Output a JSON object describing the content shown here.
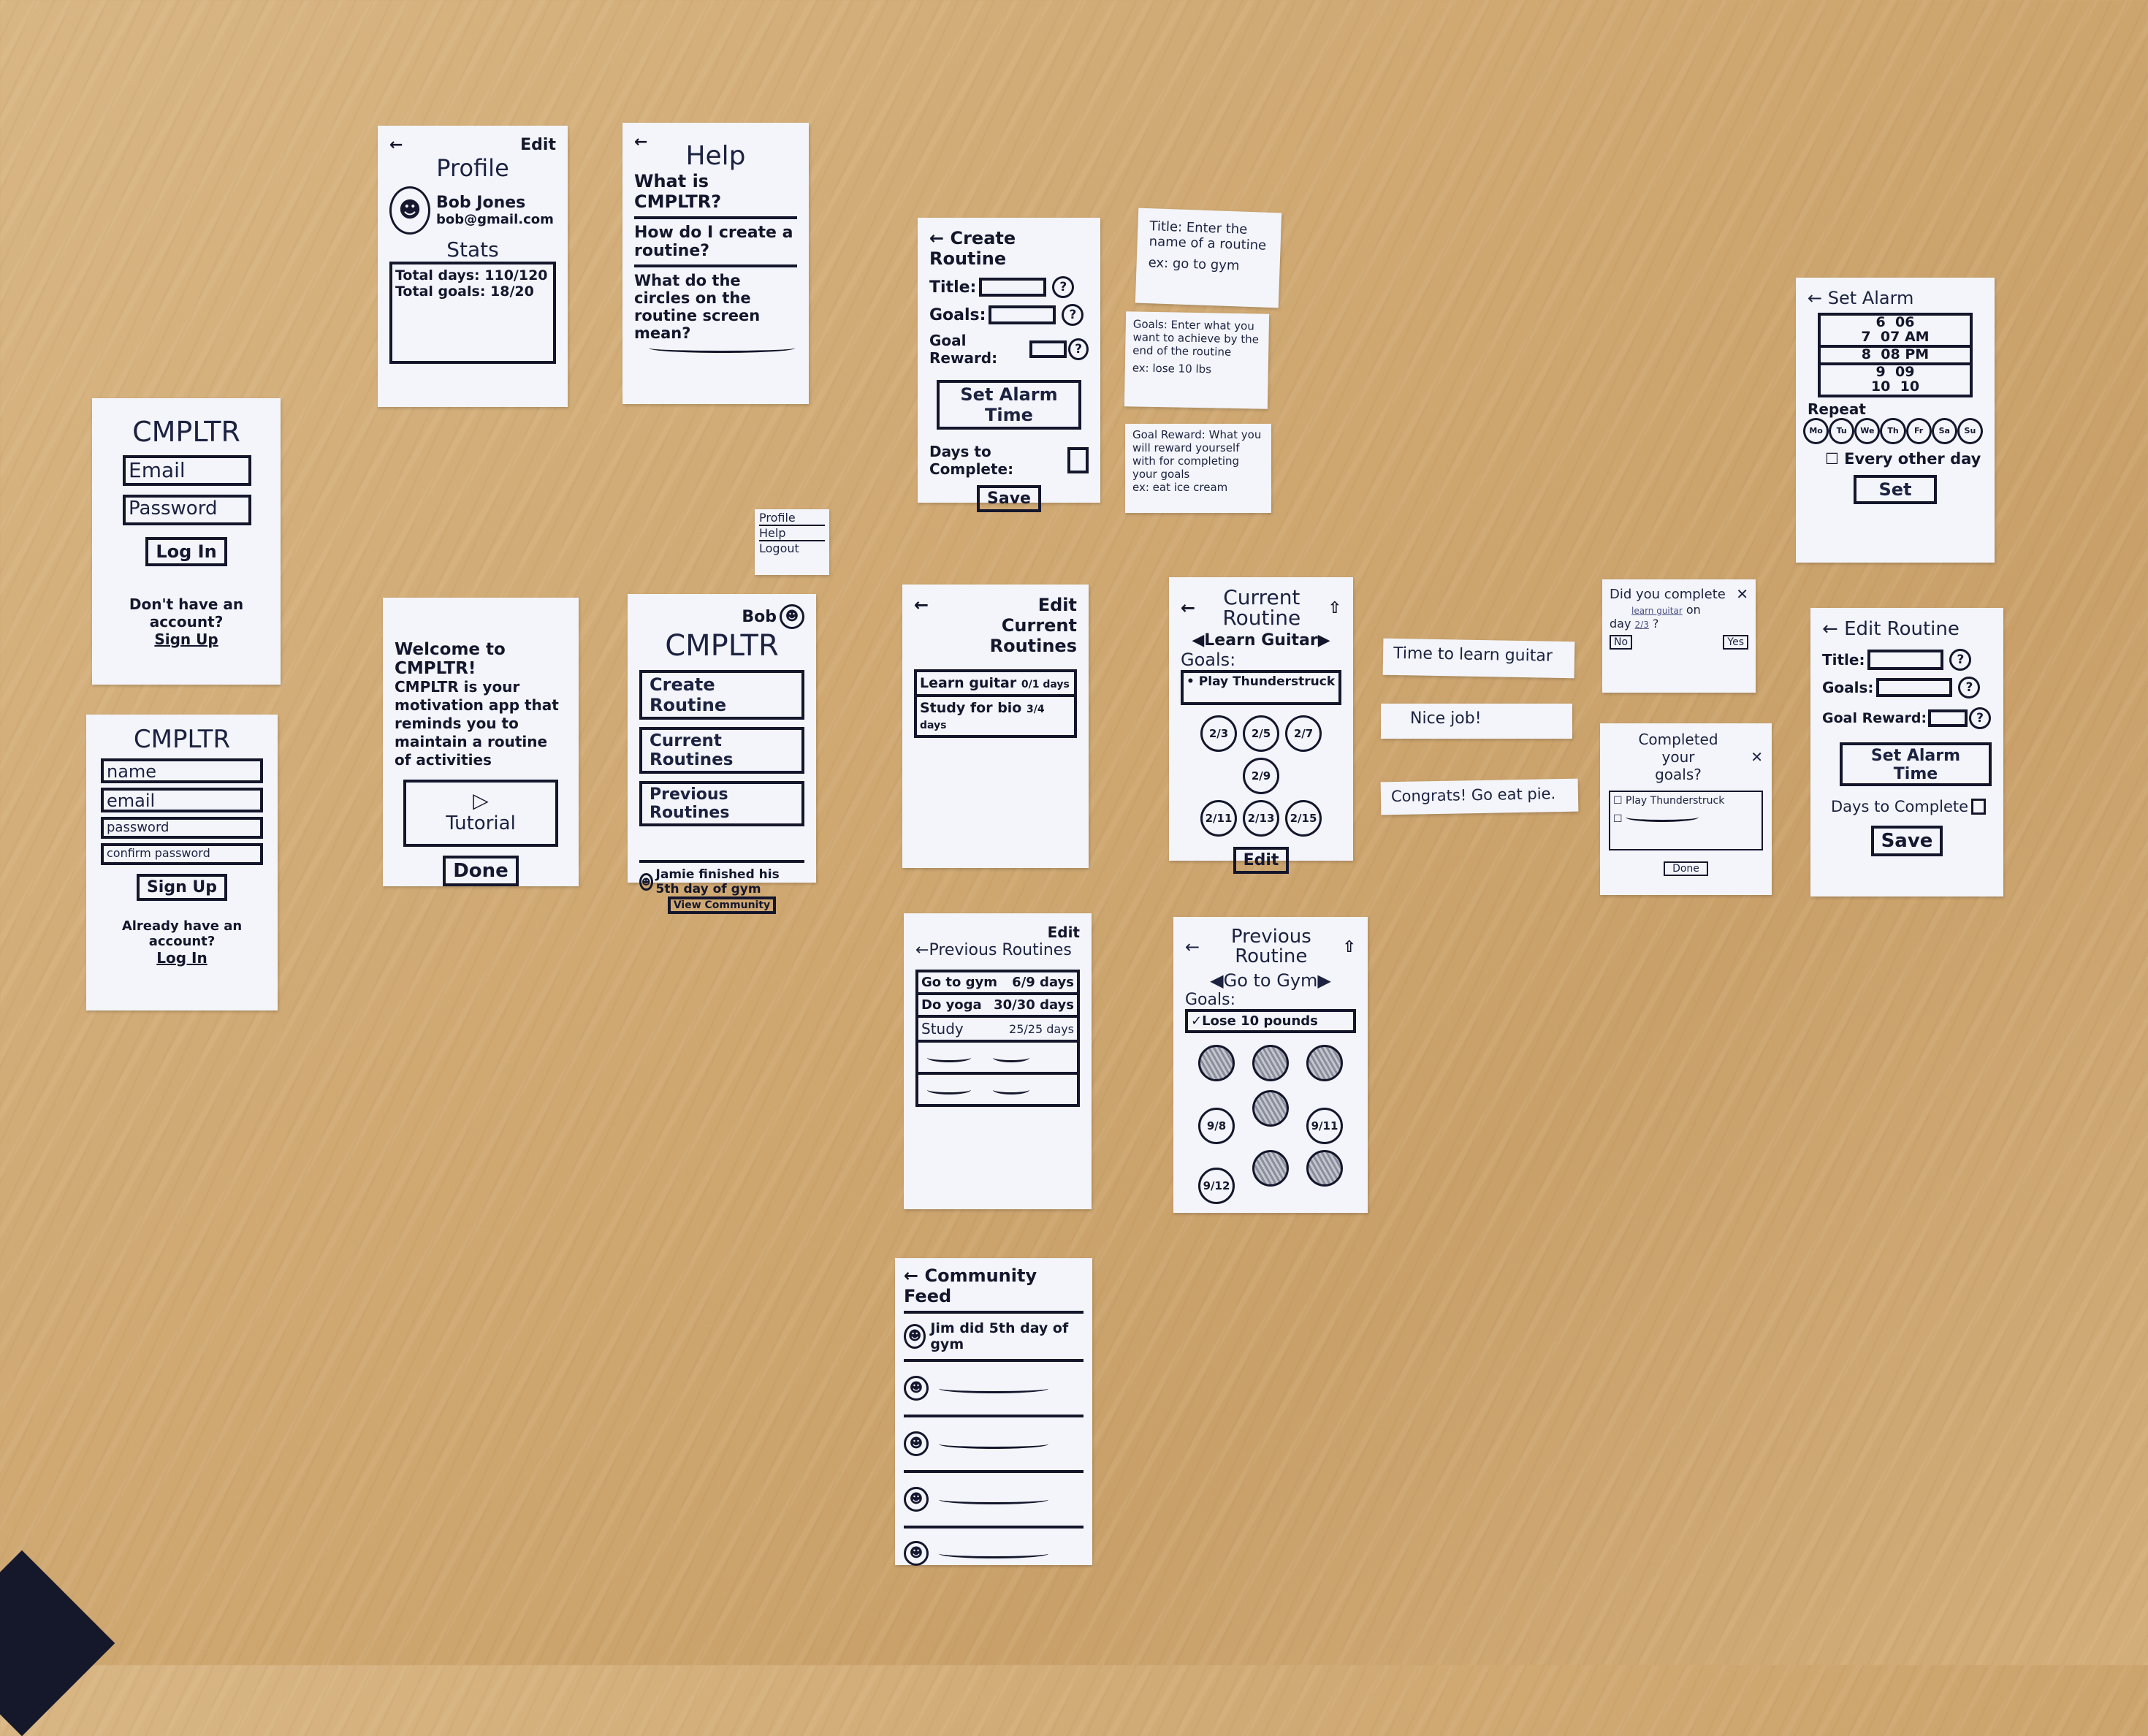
{
  "colors": {
    "table": "#cfa872",
    "paper": "#f3f5fb",
    "ink": "#14162c"
  },
  "login": {
    "title": "CMPLTR",
    "email_placeholder": "Email",
    "password_placeholder": "Password",
    "login_button": "Log In",
    "no_account_text": "Don't have an account?",
    "signup_link": "Sign Up"
  },
  "signup": {
    "title": "CMPLTR",
    "name_placeholder": "name",
    "email_placeholder": "email",
    "password_placeholder": "password",
    "confirm_placeholder": "confirm password",
    "signup_button": "Sign Up",
    "have_account_text": "Already have an account?",
    "login_link": "Log In"
  },
  "profile": {
    "back_icon": "arrow-left-icon",
    "edit_label": "Edit",
    "title": "Profile",
    "name": "Bob Jones",
    "email": "bob@gmail.com",
    "stats_title": "Stats",
    "total_days": "Total days: 110/120",
    "total_goals": "Total goals: 18/20"
  },
  "help": {
    "back_icon": "arrow-left-icon",
    "title": "Help",
    "faqs": [
      "What is CMPLTR?",
      "How do I create a routine?",
      "What do the circles on the routine screen mean?"
    ]
  },
  "welcome": {
    "heading": "Welcome to CMPLTR!",
    "body": "CMPLTR is your motivation app that reminds you to maintain a routine of activities",
    "tutorial_label": "Tutorial",
    "done_button": "Done"
  },
  "menu": {
    "items": [
      "Profile",
      "Help",
      "Logout"
    ]
  },
  "home": {
    "user_name": "Bob",
    "title": "CMPLTR",
    "buttons": [
      "Create Routine",
      "Current Routines",
      "Previous Routines"
    ],
    "feed_text": "Jamie finished his 5th day of gym",
    "view_community_button": "View Community"
  },
  "create_routine": {
    "title": "Create Routine",
    "title_label": "Title:",
    "goals_label": "Goals:",
    "reward_label": "Goal Reward:",
    "alarm_button": "Set Alarm Time",
    "days_label": "Days to Complete:",
    "save_button": "Save"
  },
  "tooltips": [
    {
      "text": "Title: Enter the name of a routine",
      "example": "ex: go to gym"
    },
    {
      "text": "Goals: Enter what you want to achieve by the end of the routine",
      "example": "ex: lose 10 lbs"
    },
    {
      "text": "Goal Reward: What you will reward yourself with for completing your goals",
      "example": "ex: eat ice cream"
    }
  ],
  "current_routines": {
    "edit_label": "Edit",
    "title": "Current Routines",
    "items": [
      {
        "name": "Learn guitar",
        "progress": "0/1 days"
      },
      {
        "name": "Study for bio",
        "progress": "3/4 days"
      }
    ]
  },
  "current_routine": {
    "title": "Current Routine",
    "routine_name": "Learn Guitar",
    "goals_label": "Goals:",
    "goals": [
      "Play Thunderstruck"
    ],
    "days": [
      "2/3",
      "2/5",
      "2/7",
      "2/9",
      "2/11",
      "2/13",
      "2/15"
    ],
    "edit_button": "Edit"
  },
  "notifications": [
    "Time to learn guitar",
    "Nice job!",
    "Congrats! Go eat pie."
  ],
  "did_complete": {
    "prompt_before": "Did you complete",
    "routine": "learn guitar",
    "prompt_on": "on",
    "day_label": "day",
    "day_value": "2/3",
    "no_button": "No",
    "yes_button": "Yes"
  },
  "completed_goals": {
    "title": "Completed your goals?",
    "goals": [
      "Play Thunderstruck"
    ],
    "done_button": "Done"
  },
  "set_alarm": {
    "title": "Set Alarm",
    "picker_rows": [
      {
        "hour": "6",
        "minute": "06",
        "period": ""
      },
      {
        "hour": "7",
        "minute": "07",
        "period": "AM"
      },
      {
        "hour": "8",
        "minute": "08",
        "period": "PM"
      },
      {
        "hour": "9",
        "minute": "09",
        "period": ""
      },
      {
        "hour": "10",
        "minute": "10",
        "period": ""
      }
    ],
    "repeat_label": "Repeat",
    "days": [
      "Mo",
      "Tu",
      "We",
      "Th",
      "Fr",
      "Sa",
      "Su"
    ],
    "every_other_day": "Every other day",
    "set_button": "Set"
  },
  "edit_routine": {
    "title": "Edit Routine",
    "title_label": "Title:",
    "goals_label": "Goals:",
    "reward_label": "Goal Reward:",
    "alarm_button": "Set Alarm Time",
    "days_label": "Days to Complete",
    "save_button": "Save"
  },
  "previous_routines": {
    "edit_label": "Edit",
    "title": "Previous Routines",
    "items": [
      {
        "name": "Go to gym",
        "progress": "6/9 days"
      },
      {
        "name": "Do yoga",
        "progress": "30/30 days"
      },
      {
        "name": "Study",
        "progress": "25/25 days"
      }
    ]
  },
  "previous_routine": {
    "title": "Previous Routine",
    "routine_name": "Go to Gym",
    "goals_label": "Goals:",
    "goal": "✓Lose 10 pounds",
    "missed_days": [
      "9/8",
      "9/11",
      "9/12"
    ]
  },
  "community_feed": {
    "title": "Community Feed",
    "first_post": "Jim did 5th day of gym"
  }
}
